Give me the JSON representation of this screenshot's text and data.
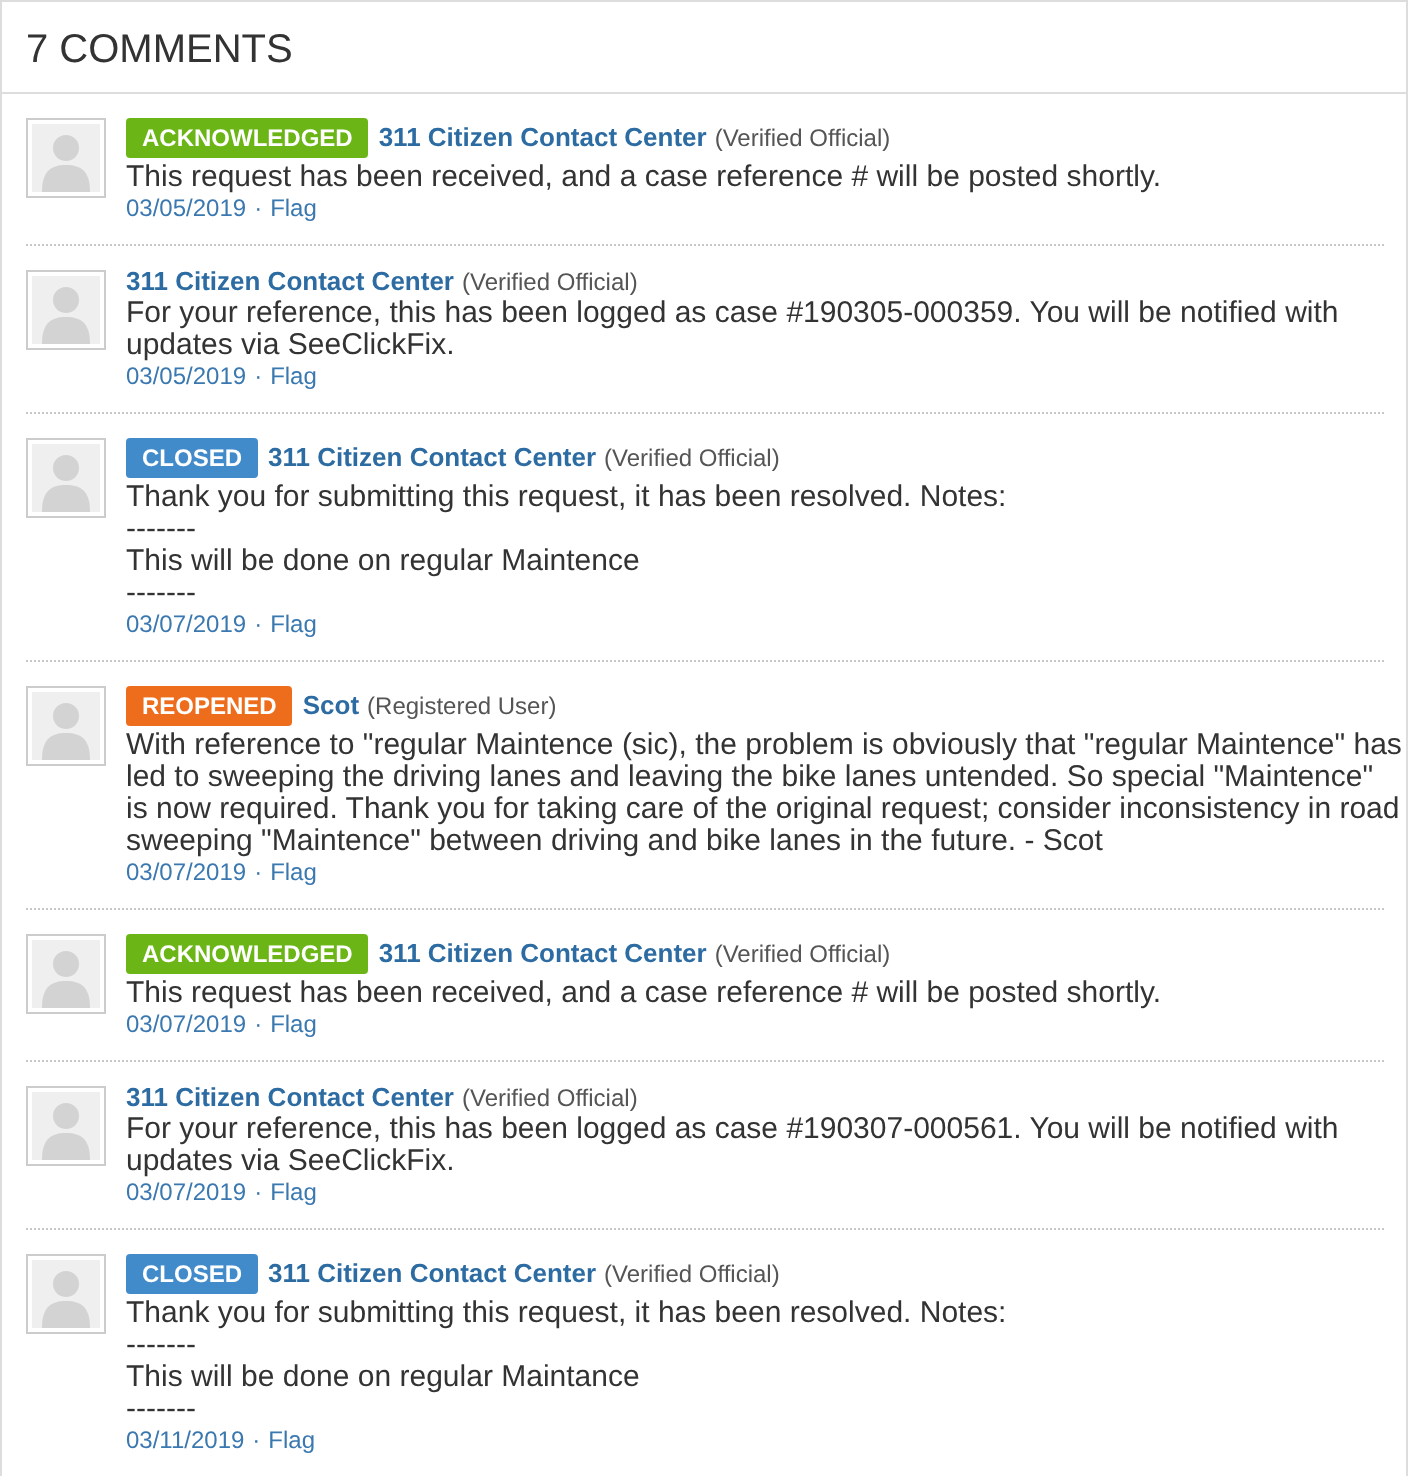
{
  "header": {
    "title": "7 COMMENTS"
  },
  "comments": [
    {
      "badge": {
        "label": "ACKNOWLEDGED",
        "color": "#6bb516"
      },
      "author": "311 Citizen Contact Center",
      "role": "(Verified Official)",
      "body": "This request has been received, and a case reference # will be posted shortly.",
      "date": "03/05/2019",
      "separator": "·",
      "flag": "Flag"
    },
    {
      "author": "311 Citizen Contact Center",
      "role": "(Verified Official)",
      "body": "For your reference, this has been logged as case #190305-000359. You will be notified with updates via SeeClickFix.",
      "date": "03/05/2019",
      "separator": "·",
      "flag": "Flag"
    },
    {
      "badge": {
        "label": "CLOSED",
        "color": "#428bca"
      },
      "author": "311 Citizen Contact Center",
      "role": "(Verified Official)",
      "body": "Thank you for submitting this request, it has been resolved. Notes:\n-------\nThis will be done on regular Maintence\n-------",
      "date": "03/07/2019",
      "separator": "·",
      "flag": "Flag"
    },
    {
      "badge": {
        "label": "REOPENED",
        "color": "#ee6d1c"
      },
      "author": "Scot",
      "role": "(Registered User)",
      "body": "With reference to \"regular Maintence (sic), the problem is obviously that \"regular Maintence\" has led to sweeping the driving lanes and leaving the bike lanes untended. So special \"Maintence\" is now required. Thank you for taking care of the original request; consider inconsistency in road sweeping \"Maintence\" between driving and bike lanes in the future. - Scot",
      "date": "03/07/2019",
      "separator": "·",
      "flag": "Flag"
    },
    {
      "badge": {
        "label": "ACKNOWLEDGED",
        "color": "#6bb516"
      },
      "author": "311 Citizen Contact Center",
      "role": "(Verified Official)",
      "body": "This request has been received, and a case reference # will be posted shortly.",
      "date": "03/07/2019",
      "separator": "·",
      "flag": "Flag"
    },
    {
      "author": "311 Citizen Contact Center",
      "role": "(Verified Official)",
      "body": "For your reference, this has been logged as case #190307-000561. You will be notified with updates via SeeClickFix.",
      "date": "03/07/2019",
      "separator": "·",
      "flag": "Flag"
    },
    {
      "badge": {
        "label": "CLOSED",
        "color": "#428bca"
      },
      "author": "311 Citizen Contact Center",
      "role": "(Verified Official)",
      "body": "Thank you for submitting this request, it has been resolved. Notes:\n-------\nThis will be done on regular Maintance\n-------",
      "date": "03/11/2019",
      "separator": "·",
      "flag": "Flag"
    }
  ]
}
